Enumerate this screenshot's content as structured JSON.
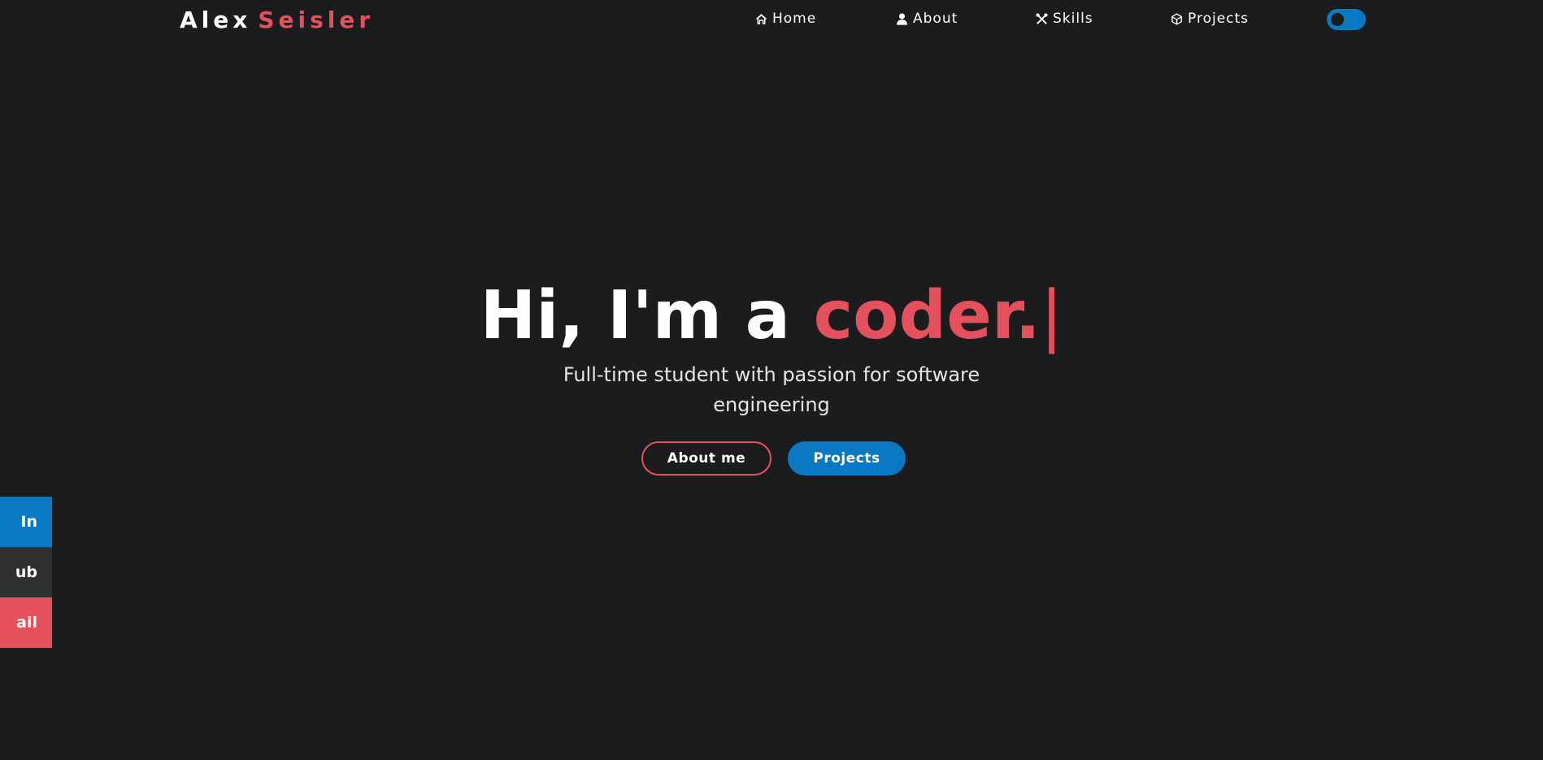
{
  "logo": {
    "first": "Alex",
    "last": "Seisler"
  },
  "nav": {
    "items": [
      {
        "label": "Home",
        "icon": "home-icon"
      },
      {
        "label": "About",
        "icon": "user-icon"
      },
      {
        "label": "Skills",
        "icon": "tools-icon"
      },
      {
        "label": "Projects",
        "icon": "cube-icon"
      }
    ],
    "theme_toggle": {
      "state": "on"
    }
  },
  "hero": {
    "title_prefix": "Hi, I'm a",
    "title_word": "coder.",
    "cursor": "|",
    "subtitle": "Full-time student with passion for software engineering",
    "buttons": {
      "about": "About me",
      "projects": "Projects"
    }
  },
  "social": {
    "linkedin": "In",
    "github": "ub",
    "email": "ail"
  },
  "colors": {
    "background": "#1b1c1e",
    "accent_red": "#e5505d",
    "accent_blue": "#0a78c2",
    "github_gray": "#2f3032"
  }
}
